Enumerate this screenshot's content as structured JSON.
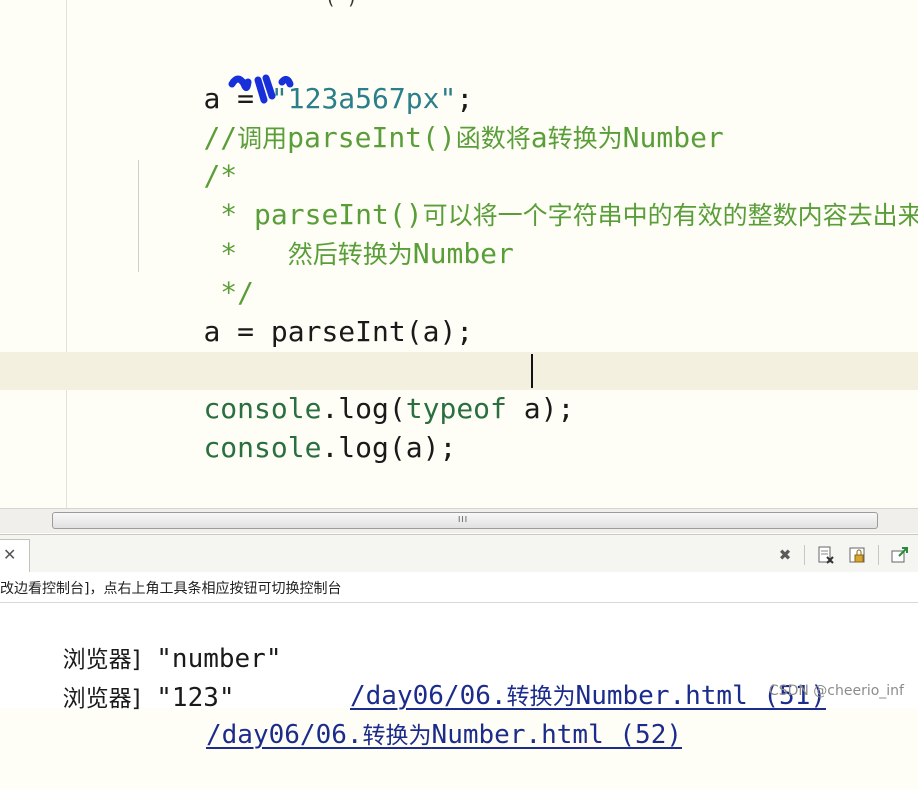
{
  "editor": {
    "partial_top": "( )",
    "lines": {
      "l1": {
        "var": "a",
        "eq": " = ",
        "str": "\"123a567px\"",
        "semi": ";"
      },
      "l2": {
        "slashes": "//",
        "cn1": "调用",
        "code": "parseInt()",
        "cn2": "函数将",
        "a": "a",
        "cn3": "转换为",
        "word": "Number"
      },
      "l3": {
        "text": "/*"
      },
      "l4": {
        "star": " * ",
        "code": "parseInt()",
        "cn": "可以将一个字符串中的有效的整数内容去出来，"
      },
      "l5": {
        "star": " *   ",
        "cn": "然后转换为",
        "word": "Number"
      },
      "l6": {
        "text": " */"
      },
      "l7": {
        "text": "a = parseInt(a);"
      },
      "l8": {
        "obj": "console",
        "rest": ".log(",
        "kw": "typeof",
        "end": " a);"
      },
      "l9": {
        "obj": "console",
        "rest": ".log(a);"
      }
    }
  },
  "scrollbar": {
    "grip": "III"
  },
  "console": {
    "toolbar_icons": [
      "clear-icon",
      "export-icon",
      "lock-icon",
      "detach-icon"
    ],
    "hint": "改边看控制台]，点右上角工具条相应按钮可切换控制台",
    "rows": [
      {
        "prefix": "浏览器]",
        "value": " \"number\"",
        "src_a": "/day06/06.",
        "src_cn": "转换为",
        "src_b": "Number.html (51)"
      },
      {
        "prefix": "浏览器]",
        "value": " \"123\"",
        "src_a": "/day06/06.",
        "src_cn": "转换为",
        "src_b": "Number.html (52)"
      }
    ]
  },
  "watermark": "CSDN @cheerio_inf"
}
